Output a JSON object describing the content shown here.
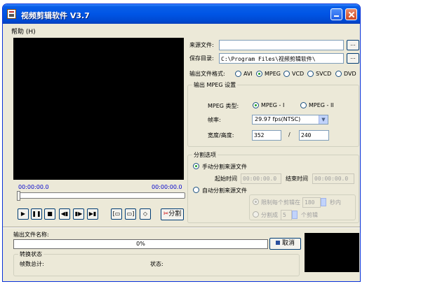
{
  "window": {
    "title": "视频剪辑软件 V3.7"
  },
  "menu": {
    "help": "帮助 (H)"
  },
  "player": {
    "time_start": "00:00:00.0",
    "time_end": "00:00:00.0",
    "controls": [
      "▶",
      "❚❚",
      "■",
      "◀▮",
      "▮▶",
      "▶▮"
    ],
    "split_label": "分割",
    "split_icon": "✂"
  },
  "source": {
    "label": "来源文件:",
    "value": "",
    "browse": "..."
  },
  "save": {
    "label": "保存目录:",
    "value": "C:\\Program Files\\视频剪辑软件\\",
    "browse": "..."
  },
  "format": {
    "label": "输出文件格式:",
    "options": [
      "AVI",
      "MPEG",
      "VCD",
      "SVCD",
      "DVD"
    ],
    "selected": "MPEG"
  },
  "mpeg": {
    "group_title": "输出 MPEG 设置",
    "type_label": "MPEG 类型:",
    "type_options": [
      "MPEG - I",
      "MPEG - II"
    ],
    "type_selected": "MPEG - I",
    "fps_label": "帧率:",
    "fps_value": "29.97 fps(NTSC)",
    "size_label": "宽度/高度:",
    "width": "352",
    "slash": "/",
    "height": "240"
  },
  "split": {
    "group_title": "分割选项",
    "manual_label": "手动分割来源文件",
    "start_label": "起始时间",
    "start_value": "00:00:00.0",
    "end_label": "结束时间",
    "end_value": "00:00:00.0",
    "auto_label": "自动分割来源文件",
    "limit_label": "限制每个剪辑在",
    "limit_value": "180",
    "limit_unit": "秒内",
    "count_label": "分割成",
    "count_value": "5",
    "count_unit": "个剪辑"
  },
  "output": {
    "name_label": "输出文件名称:",
    "progress_text": "0%",
    "progress_value": 0,
    "cancel_label": "取消",
    "status_group": "转换状态",
    "frames_label": "帧数总计:",
    "status_label": "状态:"
  }
}
